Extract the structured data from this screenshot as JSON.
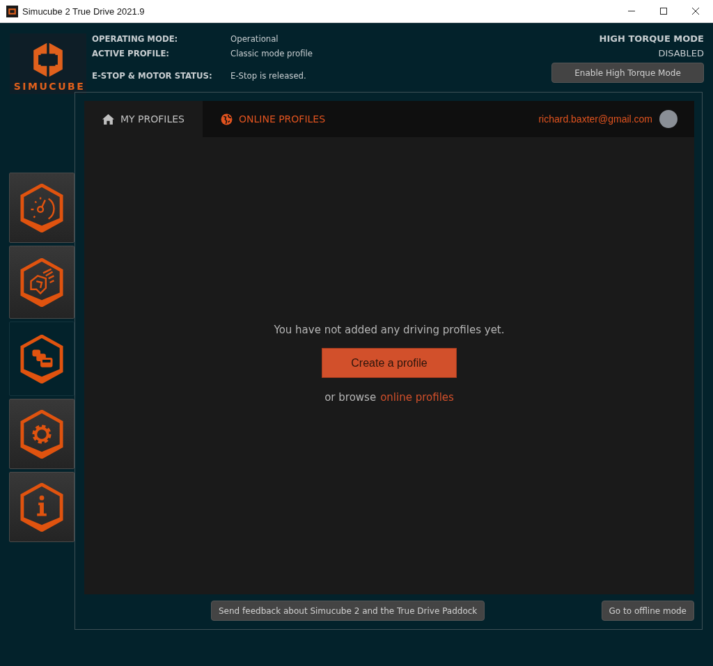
{
  "window": {
    "title": "Simucube 2 True Drive 2021.9"
  },
  "logo": {
    "text": "SIMUCUBE"
  },
  "status": [
    {
      "label": "OPERATING MODE:",
      "value": "Operational"
    },
    {
      "label": "ACTIVE PROFILE:",
      "value": "Classic mode profile"
    },
    {
      "label": "E-STOP & MOTOR STATUS:",
      "value": "E-Stop is released."
    }
  ],
  "high_torque": {
    "title": "HIGH TORQUE MODE",
    "state": "DISABLED",
    "button": "Enable High Torque Mode"
  },
  "sidebar": {
    "items": [
      {
        "kind": "gauge",
        "selected": false
      },
      {
        "kind": "wheel",
        "selected": false
      },
      {
        "kind": "cars",
        "selected": true
      },
      {
        "kind": "gear",
        "selected": false
      },
      {
        "kind": "info",
        "selected": false
      }
    ]
  },
  "tabs": [
    {
      "label": "MY PROFILES",
      "kind": "home",
      "selected": true
    },
    {
      "label": "ONLINE PROFILES",
      "kind": "globe",
      "selected": false
    }
  ],
  "account": {
    "email": "richard.baxter@gmail.com"
  },
  "empty_state": {
    "message": "You have not added any driving profiles yet.",
    "button": "Create a profile",
    "browse_prefix": "or browse",
    "browse_link": "online profiles"
  },
  "footer": {
    "feedback_button": "Send feedback about Simucube 2 and the True Drive Paddock",
    "offline_button": "Go to offline mode"
  }
}
